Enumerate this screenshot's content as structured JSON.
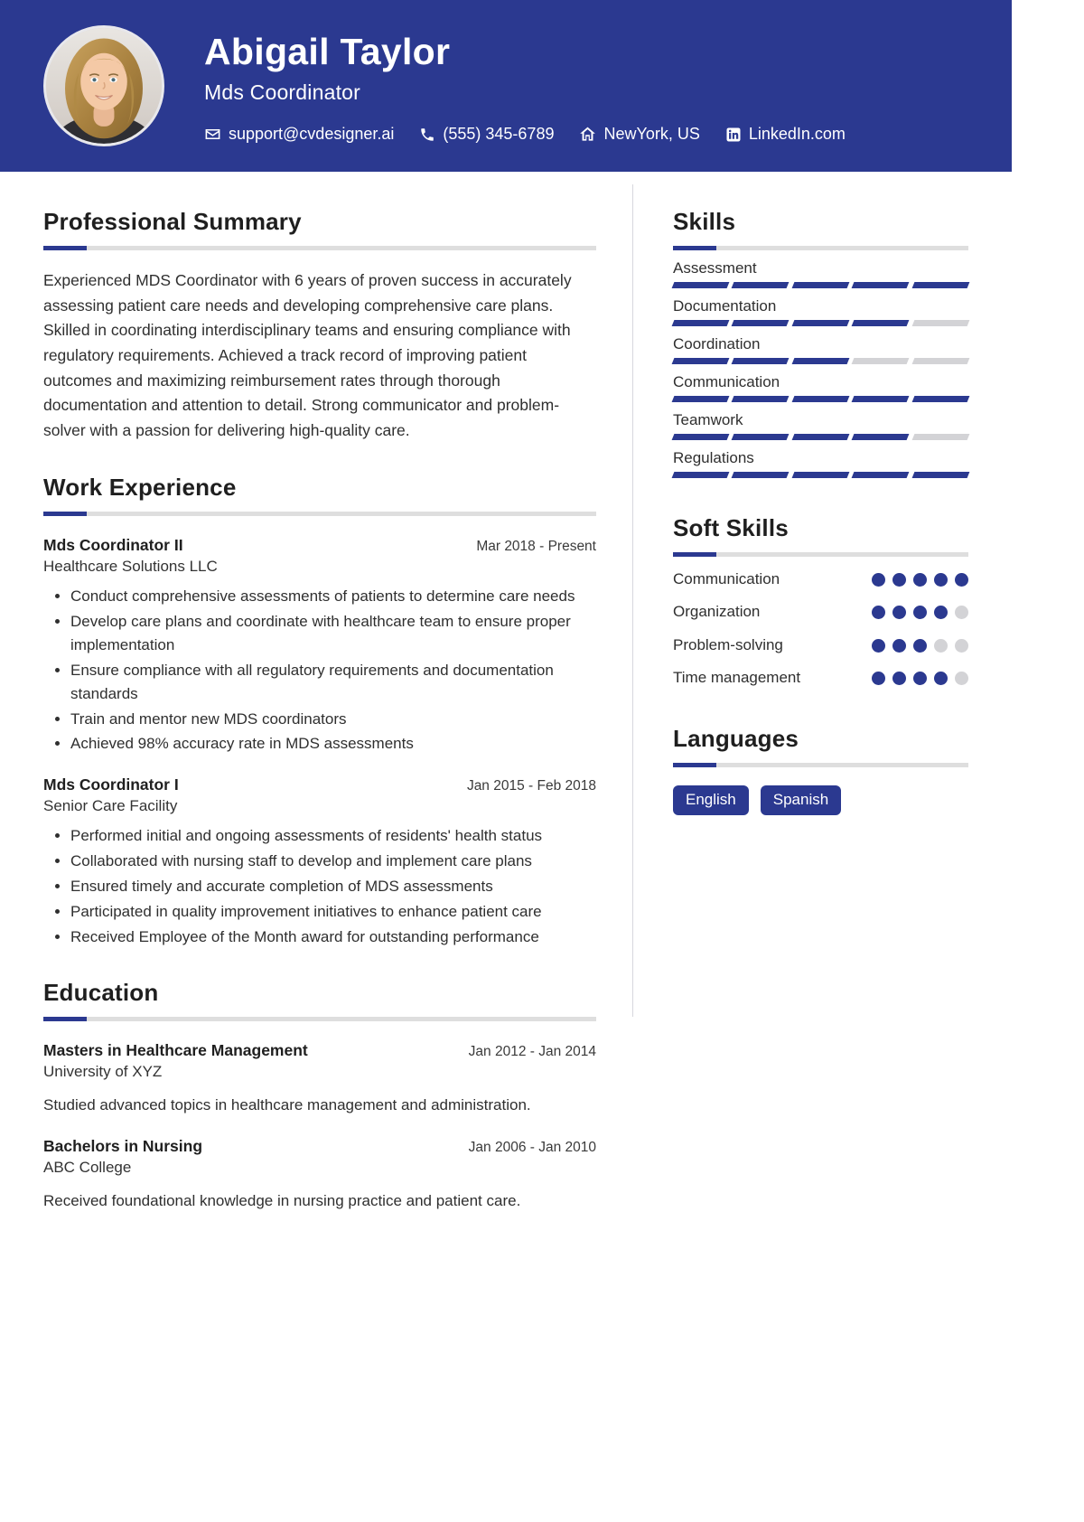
{
  "header": {
    "name": "Abigail Taylor",
    "role": "Mds Coordinator",
    "avatar_alt": "profile-photo",
    "contacts": [
      {
        "icon": "email-icon",
        "text": "support@cvdesigner.ai"
      },
      {
        "icon": "phone-icon",
        "text": "(555) 345-6789"
      },
      {
        "icon": "location-icon",
        "text": "NewYork, US"
      },
      {
        "icon": "linkedin-icon",
        "text": "LinkedIn.com"
      }
    ],
    "background_color": "#2b3990"
  },
  "accent_color": "#2b3990",
  "muted_color": "#d3d3d6",
  "summary": {
    "title": "Professional Summary",
    "text": "Experienced MDS Coordinator with 6 years of proven success in accurately assessing patient care needs and developing comprehensive care plans. Skilled in coordinating interdisciplinary teams and ensuring compliance with regulatory requirements. Achieved a track record of improving patient outcomes and maximizing reimbursement rates through thorough documentation and attention to detail. Strong communicator and problem-solver with a passion for delivering high-quality care."
  },
  "experience": {
    "title": "Work Experience",
    "entries": [
      {
        "title": "Mds Coordinator II",
        "date": "Mar 2018 - Present",
        "org": "Healthcare Solutions LLC",
        "bullets": [
          "Conduct comprehensive assessments of patients to determine care needs",
          "Develop care plans and coordinate with healthcare team to ensure proper implementation",
          "Ensure compliance with all regulatory requirements and documentation standards",
          "Train and mentor new MDS coordinators",
          "Achieved 98% accuracy rate in MDS assessments"
        ]
      },
      {
        "title": "Mds Coordinator I",
        "date": "Jan 2015 - Feb 2018",
        "org": "Senior Care Facility",
        "bullets": [
          "Performed initial and ongoing assessments of residents' health status",
          "Collaborated with nursing staff to develop and implement care plans",
          "Ensured timely and accurate completion of MDS assessments",
          "Participated in quality improvement initiatives to enhance patient care",
          "Received Employee of the Month award for outstanding performance"
        ]
      }
    ]
  },
  "education": {
    "title": "Education",
    "entries": [
      {
        "title": "Masters in Healthcare Management",
        "date": "Jan 2012 - Jan 2014",
        "org": "University of XYZ",
        "desc": "Studied advanced topics in healthcare management and administration."
      },
      {
        "title": "Bachelors in Nursing",
        "date": "Jan 2006 - Jan 2010",
        "org": "ABC College",
        "desc": "Received foundational knowledge in nursing practice and patient care."
      }
    ]
  },
  "skills": {
    "title": "Skills",
    "max": 5,
    "items": [
      {
        "name": "Assessment",
        "level": 5
      },
      {
        "name": "Documentation",
        "level": 4
      },
      {
        "name": "Coordination",
        "level": 3
      },
      {
        "name": "Communication",
        "level": 5
      },
      {
        "name": "Teamwork",
        "level": 4
      },
      {
        "name": "Regulations",
        "level": 5
      }
    ]
  },
  "soft_skills": {
    "title": "Soft Skills",
    "max": 5,
    "items": [
      {
        "name": "Communication",
        "level": 5
      },
      {
        "name": "Organization",
        "level": 4
      },
      {
        "name": "Problem-solving",
        "level": 3
      },
      {
        "name": "Time management",
        "level": 4
      }
    ]
  },
  "languages": {
    "title": "Languages",
    "items": [
      "English",
      "Spanish"
    ]
  }
}
